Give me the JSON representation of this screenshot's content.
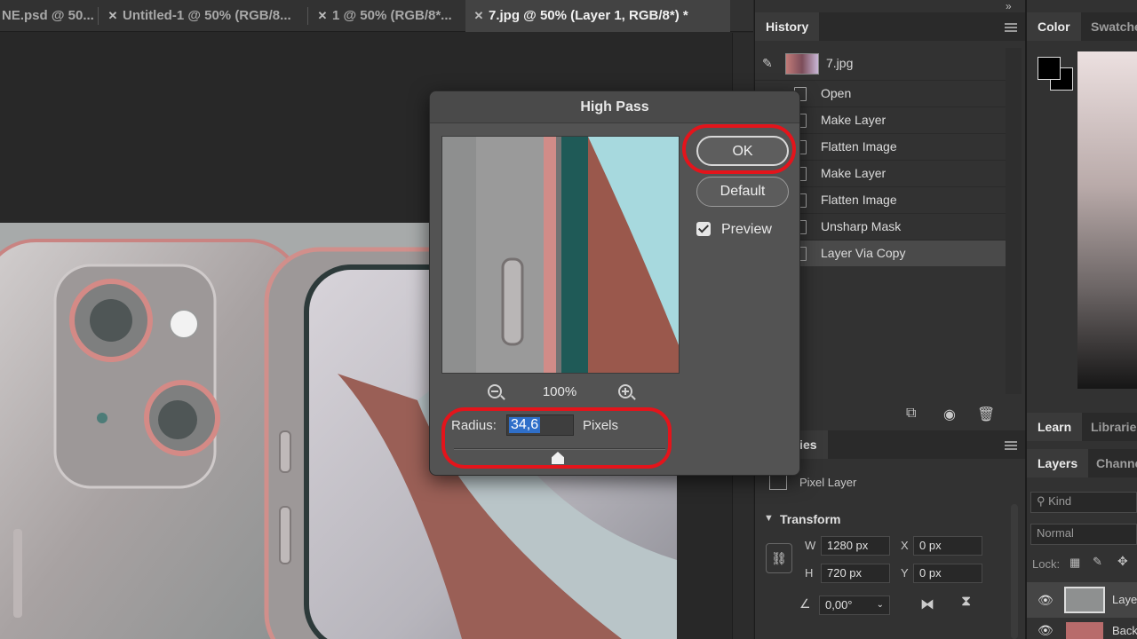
{
  "tabs": [
    {
      "label": "NE.psd @ 50..."
    },
    {
      "label": "Untitled-1 @ 50% (RGB/8..."
    },
    {
      "label": "1 @ 50% (RGB/8*..."
    },
    {
      "label": "7.jpg @ 50% (Layer 1, RGB/8*) *"
    }
  ],
  "history": {
    "tab_label": "History",
    "snapshot_label": "7.jpg",
    "items": [
      "Open",
      "Make Layer",
      "Flatten Image",
      "Make Layer",
      "Flatten Image",
      "Unsharp Mask",
      "Layer Via Copy"
    ],
    "selected_index": 6
  },
  "properties": {
    "tab_label": "rties",
    "layer_type": "Pixel Layer",
    "section": "Transform",
    "w_label": "W",
    "w_value": "1280 px",
    "h_label": "H",
    "h_value": "720 px",
    "x_label": "X",
    "x_value": "0 px",
    "y_label": "Y",
    "y_value": "0 px",
    "angle_value": "0,00°"
  },
  "color_panel": {
    "tab_color": "Color",
    "tab_swatches": "Swatche"
  },
  "learn_panel": {
    "tab_learn": "Learn",
    "tab_libraries": "Librarie"
  },
  "layers_panel": {
    "tab_layers": "Layers",
    "tab_channels": "Channe",
    "kind_placeholder": "Kind",
    "blend_mode": "Normal",
    "lock_label": "Lock:",
    "layer1": "Laye",
    "layer2": "Back"
  },
  "dialog": {
    "title": "High Pass",
    "ok_label": "OK",
    "default_label": "Default",
    "preview_label": "Preview",
    "preview_checked": true,
    "zoom_level": "100%",
    "radius_label": "Radius:",
    "radius_value": "34,6",
    "radius_unit": "Pixels",
    "highlight_color": "#e4141b"
  }
}
